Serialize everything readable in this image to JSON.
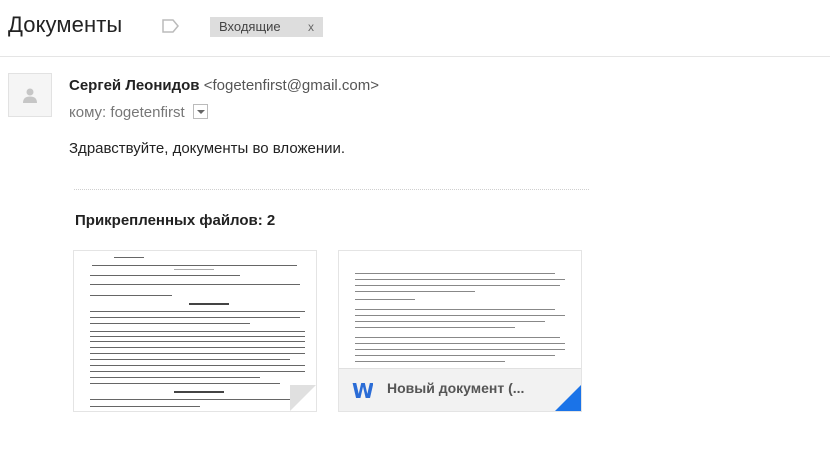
{
  "header": {
    "subject": "Документы",
    "label_icon": "label-icon",
    "label_chip": {
      "text": "Входящие",
      "close": "x"
    }
  },
  "message": {
    "avatar_icon": "person-icon",
    "sender_name": "Сергей Леонидов",
    "sender_email": "<fogetenfirst@gmail.com>",
    "recipient_prefix": "кому:",
    "recipient": "fogetenfirst",
    "body": "Здравствуйте, документы  во вложении."
  },
  "attachments": {
    "count_label": "Прикрепленных файлов: 2",
    "items": [
      {
        "type": "scanned-document",
        "name": ""
      },
      {
        "type": "word-document",
        "name": "Новый документ (...",
        "icon": "word-icon",
        "accent": "#1a73e8"
      }
    ]
  }
}
